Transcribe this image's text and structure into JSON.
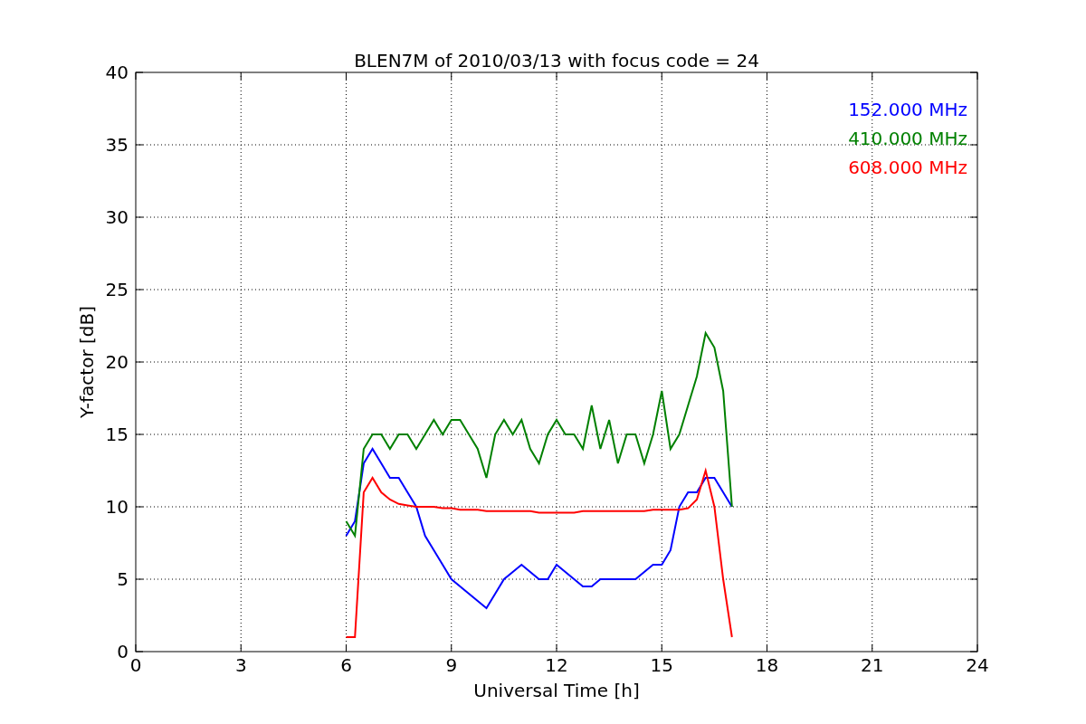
{
  "figure": {
    "chart_data": {
      "type": "line",
      "grid": true,
      "title": "BLEN7M of 2010/03/13 with focus code = 24",
      "xlabel": "Universal Time [h]",
      "ylabel": "Y-factor [dB]",
      "xlim": [
        0,
        24
      ],
      "ylim": [
        0,
        40
      ],
      "xticks": [
        0,
        3,
        6,
        9,
        12,
        15,
        18,
        21,
        24
      ],
      "yticks": [
        0,
        5,
        10,
        15,
        20,
        25,
        30,
        35,
        40
      ],
      "x": [
        6,
        6.25,
        6.5,
        6.75,
        7,
        7.25,
        7.5,
        7.75,
        8,
        8.25,
        8.5,
        8.75,
        9,
        9.25,
        9.5,
        9.75,
        10,
        10.25,
        10.5,
        10.75,
        11,
        11.25,
        11.5,
        11.75,
        12,
        12.25,
        12.5,
        12.75,
        13,
        13.25,
        13.5,
        13.75,
        14,
        14.25,
        14.5,
        14.75,
        15,
        15.25,
        15.5,
        15.75,
        16,
        16.25,
        16.5,
        16.75,
        17
      ],
      "series": [
        {
          "name": "152.000 MHz",
          "color": "#0000ff",
          "values": [
            8,
            9,
            13,
            14,
            13,
            12,
            12,
            11,
            10,
            8,
            7,
            6,
            5,
            4.5,
            4,
            3.5,
            3,
            4,
            5,
            5.5,
            6,
            5.5,
            5,
            5,
            6,
            5.5,
            5,
            4.5,
            4.5,
            5,
            5,
            5,
            5,
            5,
            5.5,
            6,
            6,
            7,
            10,
            11,
            11,
            12,
            12,
            11,
            10
          ]
        },
        {
          "name": "410.000 MHz",
          "color": "#008000",
          "values": [
            9,
            8,
            14,
            15,
            15,
            14,
            15,
            15,
            14,
            15,
            16,
            15,
            16,
            16,
            15,
            14,
            12,
            15,
            16,
            15,
            16,
            14,
            13,
            15,
            16,
            15,
            15,
            14,
            17,
            14,
            16,
            13,
            15,
            15,
            13,
            15,
            18,
            14,
            15,
            17,
            19,
            22,
            21,
            18,
            10
          ]
        },
        {
          "name": "608.000 MHz",
          "color": "#ff0000",
          "values": [
            1,
            1,
            11,
            12,
            11,
            10.5,
            10.2,
            10.1,
            10,
            10,
            10,
            9.9,
            9.9,
            9.8,
            9.8,
            9.8,
            9.7,
            9.7,
            9.7,
            9.7,
            9.7,
            9.7,
            9.6,
            9.6,
            9.6,
            9.6,
            9.6,
            9.7,
            9.7,
            9.7,
            9.7,
            9.7,
            9.7,
            9.7,
            9.7,
            9.8,
            9.8,
            9.8,
            9.8,
            9.9,
            10.5,
            12.5,
            10,
            5,
            1
          ]
        }
      ]
    }
  }
}
